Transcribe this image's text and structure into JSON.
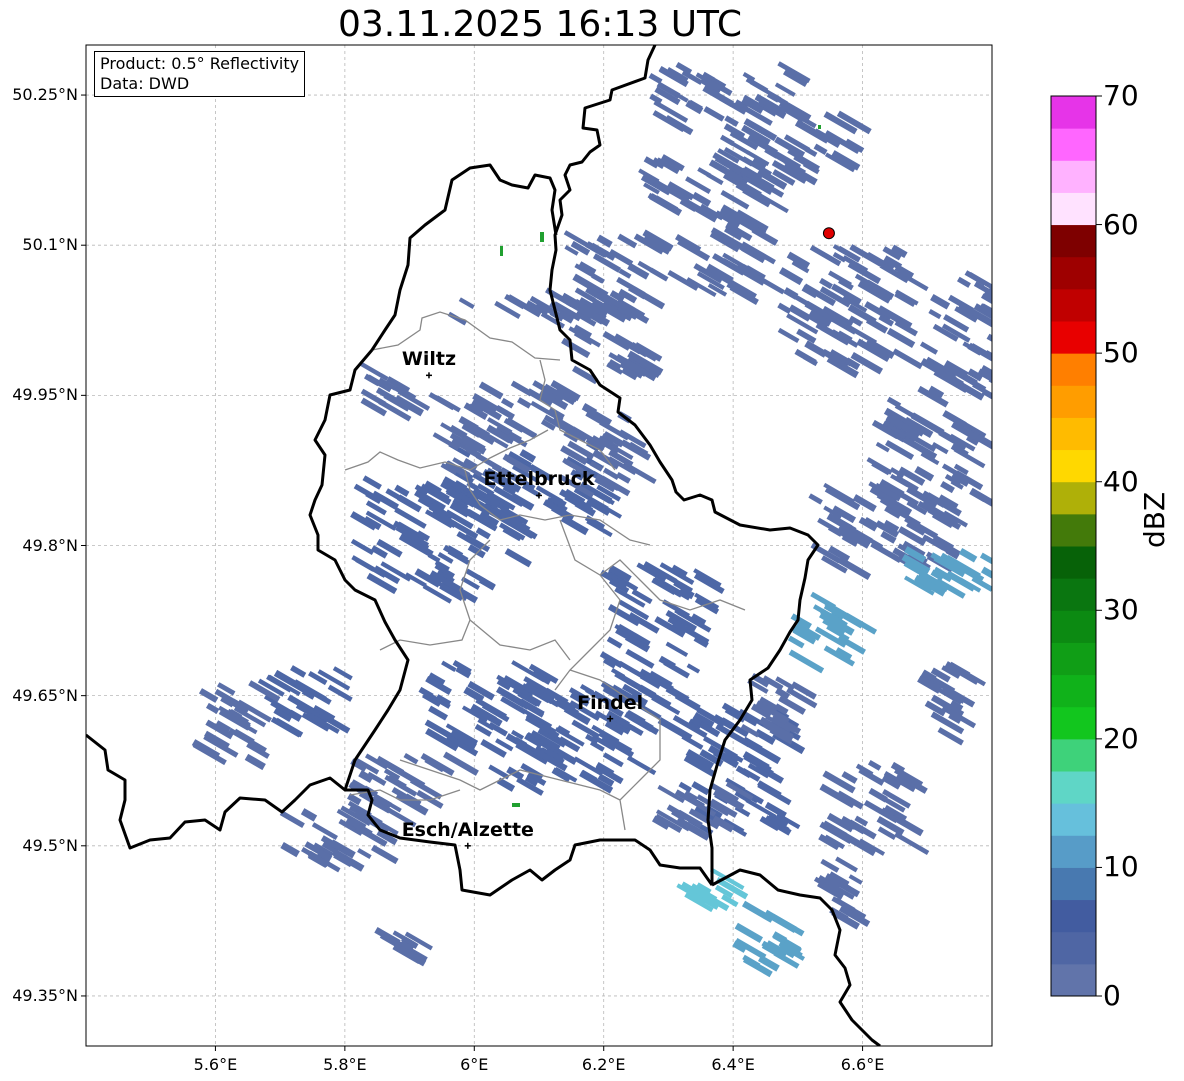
{
  "title": "03.11.2025 16:13 UTC",
  "info": {
    "product": "Product: 0.5° Reflectivity",
    "source": "Data: DWD"
  },
  "axes": {
    "lat_labels": [
      "50.25°N",
      "50.1°N",
      "49.95°N",
      "49.8°N",
      "49.65°N",
      "49.5°N",
      "49.35°N"
    ],
    "lat_values": [
      50.25,
      50.1,
      49.95,
      49.8,
      49.65,
      49.5,
      49.35
    ],
    "lon_labels": [
      "5.6°E",
      "5.8°E",
      "6°E",
      "6.2°E",
      "6.4°E",
      "6.6°E"
    ],
    "lon_values": [
      5.6,
      5.8,
      6.0,
      6.2,
      6.4,
      6.6
    ],
    "lon_range": [
      5.4,
      6.8
    ],
    "lat_range": [
      49.3,
      50.3
    ]
  },
  "cities": [
    {
      "name": "Wiltz",
      "lon": 5.93,
      "lat": 49.97
    },
    {
      "name": "Ettelbruck",
      "lon": 6.1,
      "lat": 49.85
    },
    {
      "name": "Findel",
      "lon": 6.21,
      "lat": 49.627
    },
    {
      "name": "Esch/Alzette",
      "lon": 5.99,
      "lat": 49.5
    }
  ],
  "marker": {
    "lon": 6.548,
    "lat": 50.112,
    "color": "#e00000"
  },
  "colorbar": {
    "label": "dBZ",
    "ticks": [
      "0",
      "10",
      "20",
      "30",
      "40",
      "50",
      "60",
      "70"
    ],
    "tick_values": [
      0,
      10,
      20,
      30,
      40,
      50,
      60,
      70
    ],
    "colors": [
      "#6174aa",
      "#4f66a4",
      "#425ca0",
      "#4879b0",
      "#579cc8",
      "#66c0dc",
      "#5fd6c6",
      "#3ed27a",
      "#12c61e",
      "#10b21a",
      "#109e16",
      "#0c8a12",
      "#0a7610",
      "#076208",
      "#437a0a",
      "#afb008",
      "#ffd800",
      "#ffbb00",
      "#ff9d00",
      "#ff7f00",
      "#e80000",
      "#c00000",
      "#9e0000",
      "#7e0000",
      "#ffe2ff",
      "#ffb2ff",
      "#ff66ff",
      "#e634e8"
    ]
  },
  "colors": {
    "echo_weak": "#5a6fa8",
    "echo_mid": "#4d67a6",
    "echo_light": "#5aa2c8",
    "echo_cyan": "#64c6d8",
    "echo_green": "#20a030",
    "border": "#000000",
    "canton": "#888888"
  }
}
